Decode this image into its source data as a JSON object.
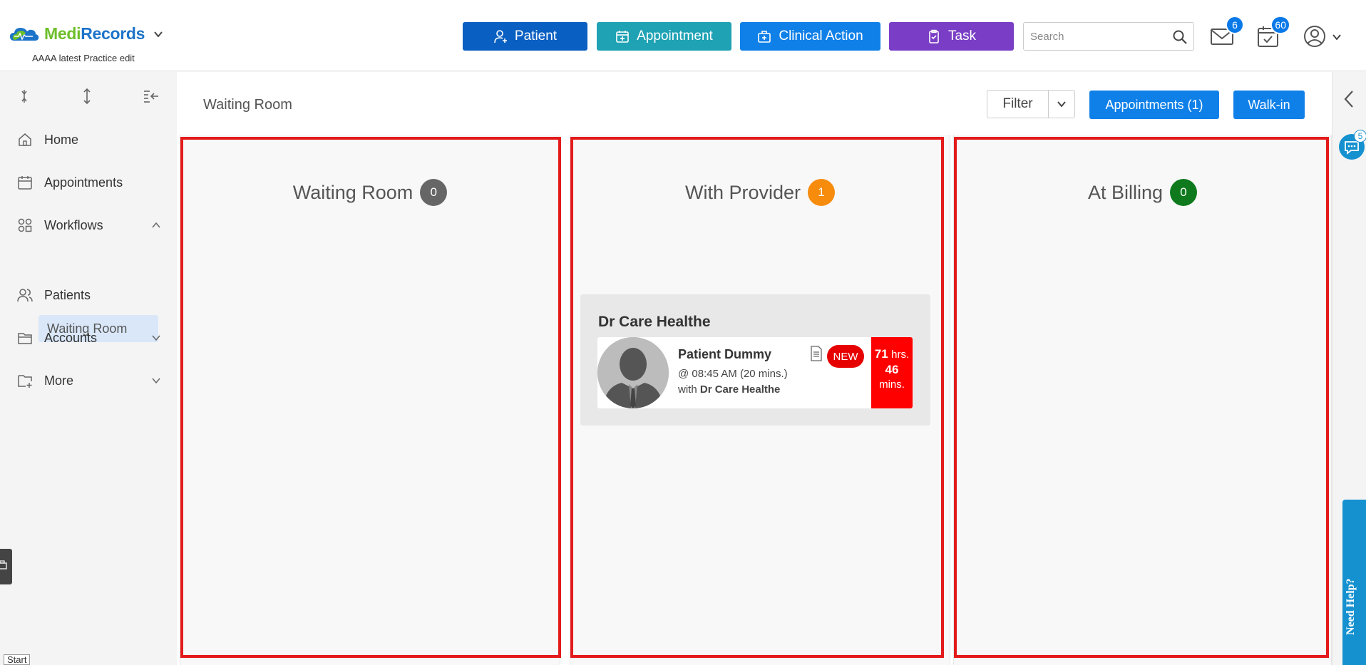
{
  "header": {
    "brand_part1": "Medi",
    "brand_part2": "Records",
    "practice": "AAAA latest Practice edit",
    "buttons": {
      "patient": "Patient",
      "appointment": "Appointment",
      "clinical_action": "Clinical Action",
      "task": "Task"
    },
    "search_placeholder": "Search",
    "mail_badge": "6",
    "calendar_badge": "60",
    "colors": {
      "patient": "#0a5fc2",
      "appointment": "#1fa2b4",
      "clinical_action": "#0f80e8",
      "task": "#7a3ec6"
    }
  },
  "sidebar": {
    "items": [
      {
        "label": "Home",
        "icon": "home-icon"
      },
      {
        "label": "Appointments",
        "icon": "calendar-icon"
      },
      {
        "label": "Workflows",
        "icon": "workflow-icon"
      },
      {
        "label": "Patients",
        "icon": "users-icon"
      },
      {
        "label": "Accounts",
        "icon": "folder-icon"
      },
      {
        "label": "More",
        "icon": "folder-plus-icon"
      }
    ],
    "sub_item": "Waiting Room",
    "start_label": "Start"
  },
  "main": {
    "page_title": "Waiting Room",
    "filter_label": "Filter",
    "appointments_button": "Appointments (1)",
    "walkin_button": "Walk-in",
    "columns": [
      {
        "title": "Waiting Room",
        "count": "0"
      },
      {
        "title": "With Provider",
        "count": "1"
      },
      {
        "title": "At Billing",
        "count": "0"
      }
    ],
    "provider_group": {
      "provider": "Dr Care Healthe",
      "patient": {
        "name": "Patient Dummy",
        "time": "@ 08:45 AM (20 mins.)",
        "with_prefix": "with",
        "with_doctor": "Dr Care Healthe",
        "badge": "NEW",
        "timer_hours": "71",
        "timer_hours_unit": "hrs.",
        "timer_mins": "46",
        "timer_mins_unit": "mins."
      }
    }
  },
  "right_panel": {
    "chat_badge": "5",
    "help_label": "Need Help?"
  }
}
